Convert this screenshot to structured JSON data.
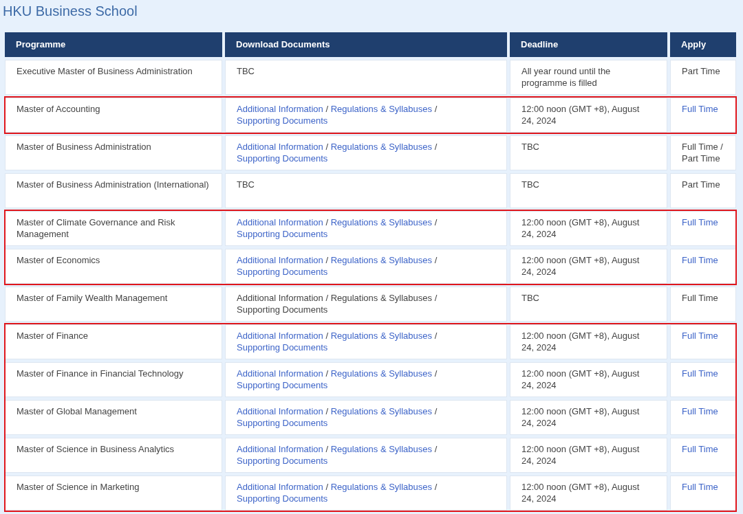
{
  "page_title": "HKU Business School",
  "columns": [
    "Programme",
    "Download Documents",
    "Deadline",
    "Apply"
  ],
  "rows": [
    {
      "programme": "Executive Master of Business Administration",
      "documents": [
        {
          "kind": "text",
          "text": "TBC"
        }
      ],
      "deadline": "All year round until the programme is filled",
      "apply": {
        "text": "Part Time",
        "link": false
      },
      "highlighted": false
    },
    {
      "programme": "Master of Accounting",
      "documents": [
        {
          "kind": "link",
          "text": "Additional Information"
        },
        {
          "kind": "separator",
          "text": "/"
        },
        {
          "kind": "link",
          "text": "Regulations & Syllabuses"
        },
        {
          "kind": "separator",
          "text": "/"
        },
        {
          "kind": "link",
          "text": "Supporting Documents"
        }
      ],
      "deadline": "12:00 noon (GMT +8), August 24, 2024",
      "apply": {
        "text": "Full Time",
        "link": true
      },
      "highlighted": true
    },
    {
      "programme": "Master of Business Administration",
      "documents": [
        {
          "kind": "link",
          "text": "Additional Information"
        },
        {
          "kind": "separator",
          "text": "/"
        },
        {
          "kind": "link",
          "text": "Regulations & Syllabuses"
        },
        {
          "kind": "separator",
          "text": "/"
        },
        {
          "kind": "link",
          "text": "Supporting Documents"
        }
      ],
      "deadline": "TBC",
      "apply": {
        "text": "Full Time / Part Time",
        "link": false
      },
      "highlighted": false
    },
    {
      "programme": "Master of Business Administration (International)",
      "documents": [
        {
          "kind": "text",
          "text": "TBC"
        }
      ],
      "deadline": "TBC",
      "apply": {
        "text": "Part Time",
        "link": false
      },
      "highlighted": false
    },
    {
      "programme": "Master of Climate Governance and Risk Management",
      "documents": [
        {
          "kind": "link",
          "text": "Additional Information"
        },
        {
          "kind": "separator",
          "text": "/"
        },
        {
          "kind": "link",
          "text": "Regulations & Syllabuses"
        },
        {
          "kind": "separator",
          "text": "/"
        },
        {
          "kind": "link",
          "text": "Supporting Documents"
        }
      ],
      "deadline": "12:00 noon (GMT +8), August 24, 2024",
      "apply": {
        "text": "Full Time",
        "link": true
      },
      "highlighted": true
    },
    {
      "programme": "Master of Economics",
      "documents": [
        {
          "kind": "link",
          "text": "Additional Information"
        },
        {
          "kind": "separator",
          "text": "/"
        },
        {
          "kind": "link",
          "text": "Regulations & Syllabuses"
        },
        {
          "kind": "separator",
          "text": "/"
        },
        {
          "kind": "link",
          "text": "Supporting Documents"
        }
      ],
      "deadline": "12:00 noon (GMT +8), August 24, 2024",
      "apply": {
        "text": "Full Time",
        "link": true
      },
      "highlighted": true
    },
    {
      "programme": "Master of Family Wealth Management",
      "documents": [
        {
          "kind": "text",
          "text": "Additional Information"
        },
        {
          "kind": "separator",
          "text": "/"
        },
        {
          "kind": "text",
          "text": "Regulations & Syllabuses"
        },
        {
          "kind": "separator",
          "text": "/"
        },
        {
          "kind": "text",
          "text": "Supporting Documents"
        }
      ],
      "deadline": "TBC",
      "apply": {
        "text": "Full Time",
        "link": false
      },
      "highlighted": false
    },
    {
      "programme": "Master of Finance",
      "documents": [
        {
          "kind": "link",
          "text": "Additional Information"
        },
        {
          "kind": "separator",
          "text": "/"
        },
        {
          "kind": "link",
          "text": "Regulations & Syllabuses"
        },
        {
          "kind": "separator",
          "text": "/"
        },
        {
          "kind": "link",
          "text": "Supporting Documents"
        }
      ],
      "deadline": "12:00 noon (GMT +8), August 24, 2024",
      "apply": {
        "text": "Full Time",
        "link": true
      },
      "highlighted": true
    },
    {
      "programme": "Master of Finance in Financial Technology",
      "documents": [
        {
          "kind": "link",
          "text": "Additional Information"
        },
        {
          "kind": "separator",
          "text": "/"
        },
        {
          "kind": "link",
          "text": "Regulations & Syllabuses"
        },
        {
          "kind": "separator",
          "text": "/"
        },
        {
          "kind": "link",
          "text": "Supporting Documents"
        }
      ],
      "deadline": "12:00 noon (GMT +8), August 24, 2024",
      "apply": {
        "text": "Full Time",
        "link": true
      },
      "highlighted": true
    },
    {
      "programme": "Master of Global Management",
      "documents": [
        {
          "kind": "link",
          "text": "Additional Information"
        },
        {
          "kind": "separator",
          "text": "/"
        },
        {
          "kind": "link",
          "text": "Regulations & Syllabuses"
        },
        {
          "kind": "separator",
          "text": "/"
        },
        {
          "kind": "link",
          "text": "Supporting Documents"
        }
      ],
      "deadline": "12:00 noon (GMT +8), August 24, 2024",
      "apply": {
        "text": "Full Time",
        "link": true
      },
      "highlighted": true
    },
    {
      "programme": "Master of Science in Business Analytics",
      "documents": [
        {
          "kind": "link",
          "text": "Additional Information"
        },
        {
          "kind": "separator",
          "text": "/"
        },
        {
          "kind": "link",
          "text": "Regulations & Syllabuses"
        },
        {
          "kind": "separator",
          "text": "/"
        },
        {
          "kind": "link",
          "text": "Supporting Documents"
        }
      ],
      "deadline": "12:00 noon (GMT +8), August 24, 2024",
      "apply": {
        "text": "Full Time",
        "link": true
      },
      "highlighted": true
    },
    {
      "programme": "Master of Science in Marketing",
      "documents": [
        {
          "kind": "link",
          "text": "Additional Information"
        },
        {
          "kind": "separator",
          "text": "/"
        },
        {
          "kind": "link",
          "text": "Regulations & Syllabuses"
        },
        {
          "kind": "separator",
          "text": "/"
        },
        {
          "kind": "link",
          "text": "Supporting Documents"
        }
      ],
      "deadline": "12:00 noon (GMT +8), August 24, 2024",
      "apply": {
        "text": "Full Time",
        "link": true
      },
      "highlighted": true
    }
  ]
}
